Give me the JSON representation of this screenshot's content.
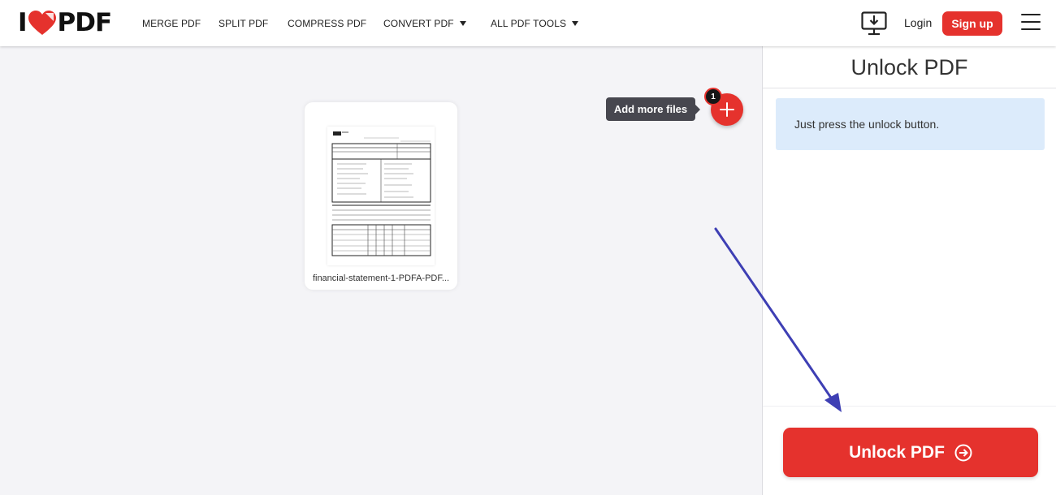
{
  "app": {
    "logo_left": "I",
    "logo_right": "PDF",
    "brand_color": "#e5322d"
  },
  "nav": {
    "items": [
      {
        "label": "MERGE PDF"
      },
      {
        "label": "SPLIT PDF"
      },
      {
        "label": "COMPRESS PDF"
      },
      {
        "label": "CONVERT PDF",
        "dropdown": true
      },
      {
        "label": "ALL PDF TOOLS",
        "dropdown": true
      }
    ],
    "desktop_icon": "desktop-download-icon",
    "login_label": "Login",
    "signup_label": "Sign up",
    "menu_icon": "hamburger-menu-icon"
  },
  "workspace": {
    "file": {
      "name": "financial-statement-1-PDFA-PDF..."
    },
    "add_more_tooltip": "Add more files",
    "file_count": "1",
    "annotation_arrow_color": "#3e3fb4"
  },
  "side_panel": {
    "title": "Unlock PDF",
    "info": "Just press the unlock button.",
    "action_label": "Unlock PDF",
    "action_icon": "circle-arrow-right-icon"
  }
}
